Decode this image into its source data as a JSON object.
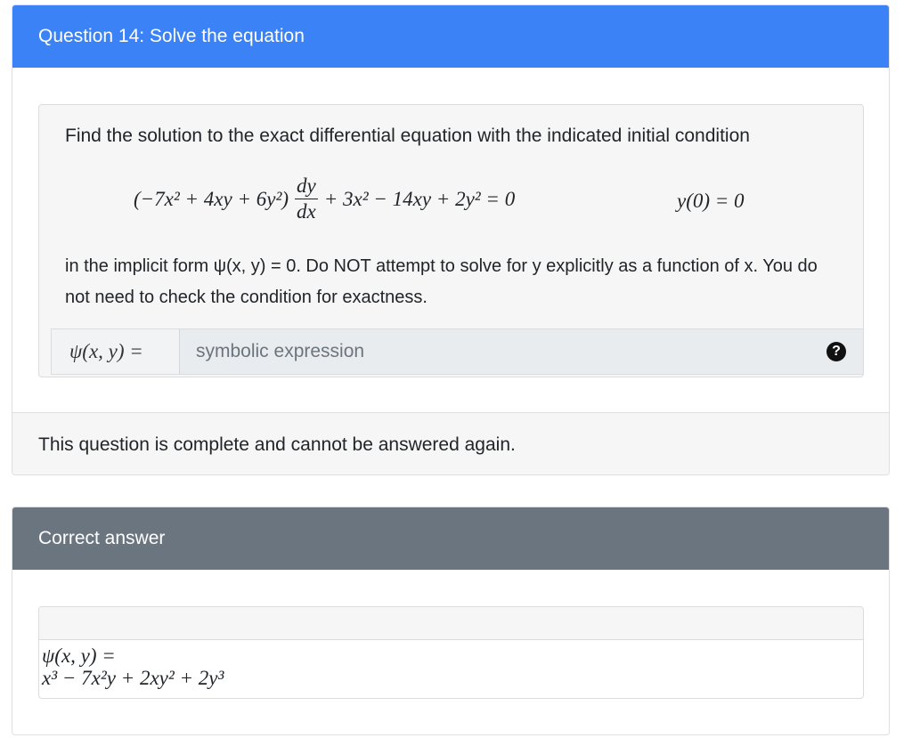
{
  "question": {
    "title": "Question 14: Solve the equation",
    "prompt": "Find the solution to the exact differential equation with the indicated initial condition",
    "equation_lhs": "(−7x² + 4xy + 6y²)",
    "equation_frac_num": "dy",
    "equation_frac_den": "dx",
    "equation_rest": "+ 3x² − 14xy + 2y² = 0",
    "initial_condition": "y(0) = 0",
    "instructions": "in the implicit form ψ(x, y) = 0. Do NOT attempt to solve for y explicitly as a function of x. You do not need to check the condition for exactness.",
    "answer_label": "ψ(x, y) =",
    "answer_placeholder": "symbolic expression",
    "help_symbol": "?",
    "status": "This question is complete and cannot be answered again."
  },
  "correct": {
    "title": "Correct answer",
    "label": "ψ(x, y) =",
    "expression": "x³ − 7x²y + 2xy² + 2y³"
  }
}
